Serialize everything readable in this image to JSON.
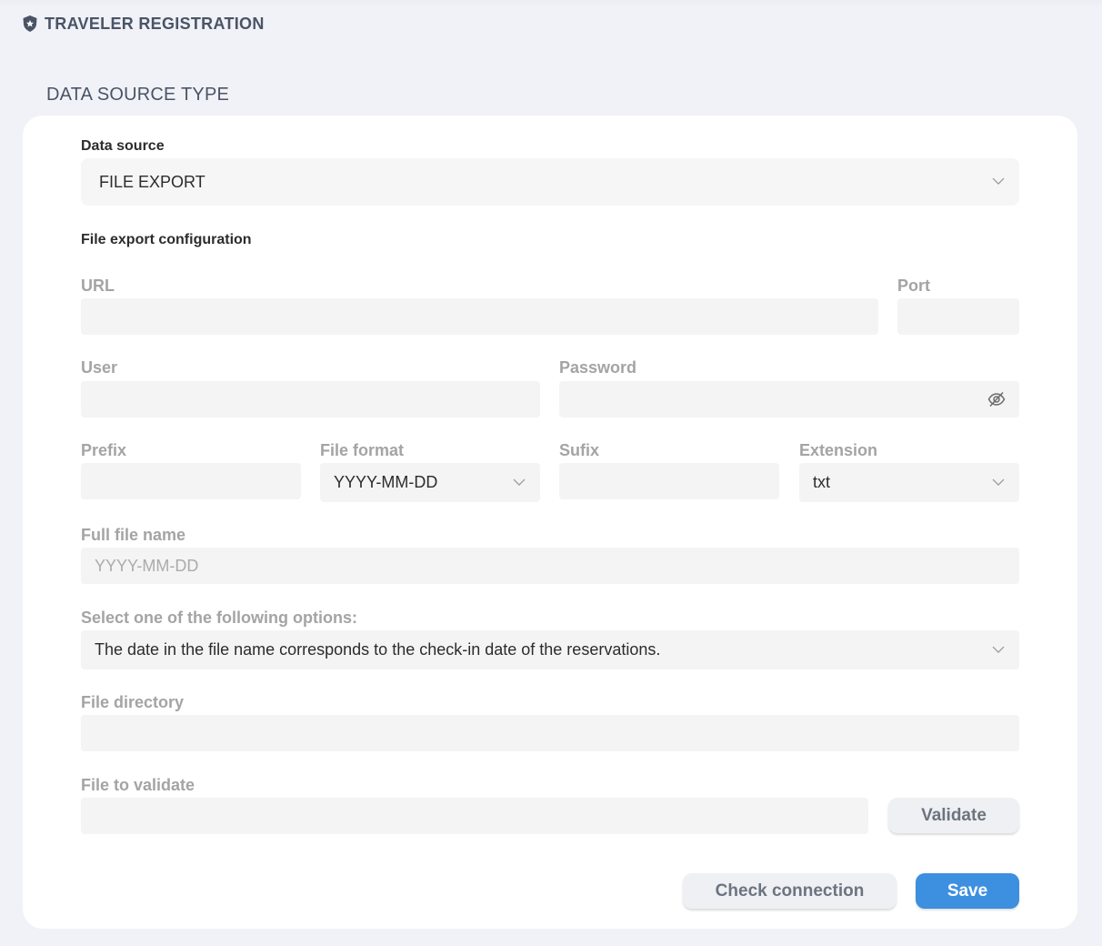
{
  "header": {
    "title": "TRAVELER REGISTRATION",
    "icon": "shield-star-icon"
  },
  "section": {
    "title": "DATA SOURCE TYPE"
  },
  "form": {
    "data_source": {
      "label": "Data source",
      "value": "FILE EXPORT"
    },
    "config_heading": "File export configuration",
    "url": {
      "label": "URL",
      "value": ""
    },
    "port": {
      "label": "Port",
      "value": ""
    },
    "user": {
      "label": "User",
      "value": ""
    },
    "password": {
      "label": "Password",
      "value": "",
      "icon": "eye-off-icon"
    },
    "prefix": {
      "label": "Prefix",
      "value": ""
    },
    "file_format": {
      "label": "File format",
      "value": "YYYY-MM-DD"
    },
    "sufix": {
      "label": "Sufix",
      "value": ""
    },
    "extension": {
      "label": "Extension",
      "value": "txt"
    },
    "full_file_name": {
      "label": "Full file name",
      "placeholder": "YYYY-MM-DD"
    },
    "option": {
      "label": "Select one of the following options:",
      "value": "The date in the file name corresponds to the check-in date of the reservations."
    },
    "file_directory": {
      "label": "File directory",
      "value": ""
    },
    "file_to_validate": {
      "label": "File to validate",
      "value": ""
    }
  },
  "buttons": {
    "validate": "Validate",
    "check_connection": "Check connection",
    "save": "Save"
  },
  "colors": {
    "accent": "#3d8fe0",
    "muted_label": "#a4a4a4",
    "field_bg": "#f4f4f4"
  }
}
